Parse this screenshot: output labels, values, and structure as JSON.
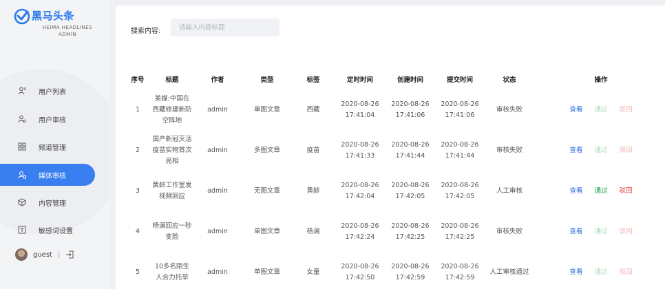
{
  "brand": {
    "title": "黑马头条",
    "subtitle_line1": "HEIMA HEADLINES",
    "subtitle_line2": "ADMIN",
    "color": "#2a78ec"
  },
  "sidebar": {
    "items": [
      {
        "label": "用户列表",
        "icon": "user-list-icon",
        "active": false
      },
      {
        "label": "用户审核",
        "icon": "user-audit-icon",
        "active": false
      },
      {
        "label": "频道管理",
        "icon": "grid-icon",
        "active": false
      },
      {
        "label": "媒体审核",
        "icon": "media-audit-icon",
        "active": true
      },
      {
        "label": "内容管理",
        "icon": "box-icon",
        "active": false
      },
      {
        "label": "敏感词设置",
        "icon": "text-box-icon",
        "active": false
      }
    ],
    "user": {
      "name": "guest",
      "separator": "|",
      "logout_icon": "logout-icon"
    },
    "active_color": "#3a7ff0"
  },
  "search": {
    "label": "搜索内容:",
    "placeholder": "请输入内容标题",
    "value": ""
  },
  "table": {
    "headers": [
      "序号",
      "标题",
      "作者",
      "类型",
      "标签",
      "定时时间",
      "创建时间",
      "提交时间",
      "状态",
      "操作"
    ],
    "rows": [
      {
        "no": "1",
        "title": "美媒:中国在西藏修建新防空阵地",
        "author": "admin",
        "type": "单图文章",
        "tag": "西藏",
        "scheduled": "2020-08-26 17:41:04",
        "created": "2020-08-26 17:41:06",
        "submitted": "2020-08-26 17:41:06",
        "status": "审核失败",
        "actions": {
          "view": "查看",
          "pass": "通过",
          "reject": "驳回"
        },
        "actions_enabled": false
      },
      {
        "no": "2",
        "title": "国产新冠灭活疫苗实物首次亮相",
        "author": "admin",
        "type": "多图文章",
        "tag": "疫苗",
        "scheduled": "2020-08-26 17:41:33",
        "created": "2020-08-26 17:41:44",
        "submitted": "2020-08-26 17:41:44",
        "status": "审核失败",
        "actions": {
          "view": "查看",
          "pass": "通过",
          "reject": "驳回"
        },
        "actions_enabled": false
      },
      {
        "no": "3",
        "title": "黄龄工作室发视频回应",
        "author": "admin",
        "type": "无图文章",
        "tag": "黄龄",
        "scheduled": "2020-08-26 17:42:04",
        "created": "2020-08-26 17:42:05",
        "submitted": "2020-08-26 17:42:05",
        "status": "人工审核",
        "actions": {
          "view": "查看",
          "pass": "通过",
          "reject": "驳回"
        },
        "actions_enabled": true
      },
      {
        "no": "4",
        "title": "杨澜回应一秒变脸",
        "author": "admin",
        "type": "单图文章",
        "tag": "杨澜",
        "scheduled": "2020-08-26 17:42:24",
        "created": "2020-08-26 17:42:25",
        "submitted": "2020-08-26 17:42:25",
        "status": "审核失败",
        "actions": {
          "view": "查看",
          "pass": "通过",
          "reject": "驳回"
        },
        "actions_enabled": false
      },
      {
        "no": "5",
        "title": "10多名陌生人合力托举",
        "author": "admin",
        "type": "单图文章",
        "tag": "女童",
        "scheduled": "2020-08-26 17:42:50",
        "created": "2020-08-26 17:42:59",
        "submitted": "2020-08-26 17:42:59",
        "status": "人工审核通过",
        "actions": {
          "view": "查看",
          "pass": "通过",
          "reject": "驳回"
        },
        "actions_enabled": false
      }
    ]
  }
}
